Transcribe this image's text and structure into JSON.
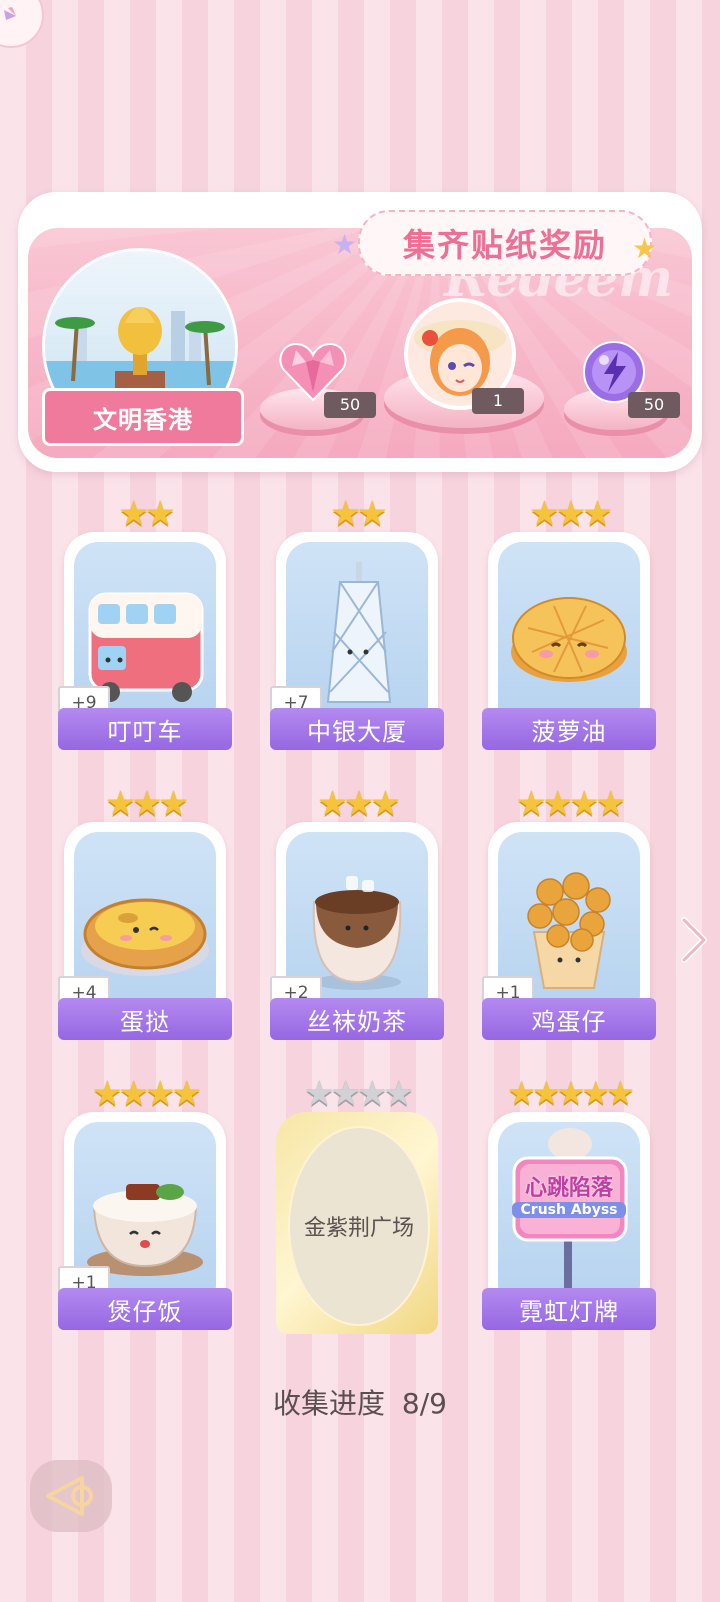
{
  "banner": {
    "title": "集齐贴纸奖励",
    "ghost_text": "Redeem",
    "location_name": "文明香港",
    "rewards": [
      {
        "icon": "pink-heart-gem-icon",
        "count": "50"
      },
      {
        "icon": "character-avatar-icon",
        "count": "1"
      },
      {
        "icon": "purple-energy-orb-icon",
        "count": "50"
      }
    ]
  },
  "stickers": [
    {
      "name": "叮叮车",
      "stars": 2,
      "count": "+9",
      "icon": "double-decker-tram-icon"
    },
    {
      "name": "中银大厦",
      "stars": 2,
      "count": "+7",
      "icon": "bank-tower-icon"
    },
    {
      "name": "菠萝油",
      "stars": 3,
      "count": "",
      "icon": "pineapple-bun-icon"
    },
    {
      "name": "蛋挞",
      "stars": 3,
      "count": "+4",
      "icon": "egg-tart-icon"
    },
    {
      "name": "丝袜奶茶",
      "stars": 3,
      "count": "+2",
      "icon": "milk-tea-icon"
    },
    {
      "name": "鸡蛋仔",
      "stars": 4,
      "count": "+1",
      "icon": "egg-waffle-icon"
    },
    {
      "name": "煲仔饭",
      "stars": 4,
      "count": "+1",
      "icon": "claypot-rice-icon"
    },
    {
      "name": "金紫荆广场",
      "stars": 4,
      "count": "",
      "icon": "locked-sticker",
      "locked": true
    },
    {
      "name": "霓虹灯牌",
      "stars": 5,
      "count": "",
      "icon": "neon-sign-icon",
      "sign_text": "心跳陷落",
      "sign_sub": "Crush Abyss"
    }
  ],
  "progress": {
    "label": "收集进度",
    "value": "8/9"
  },
  "colors": {
    "accent": "#ef6f94",
    "label_purple": "#9667e2",
    "star_gold": "#f5c43c"
  }
}
